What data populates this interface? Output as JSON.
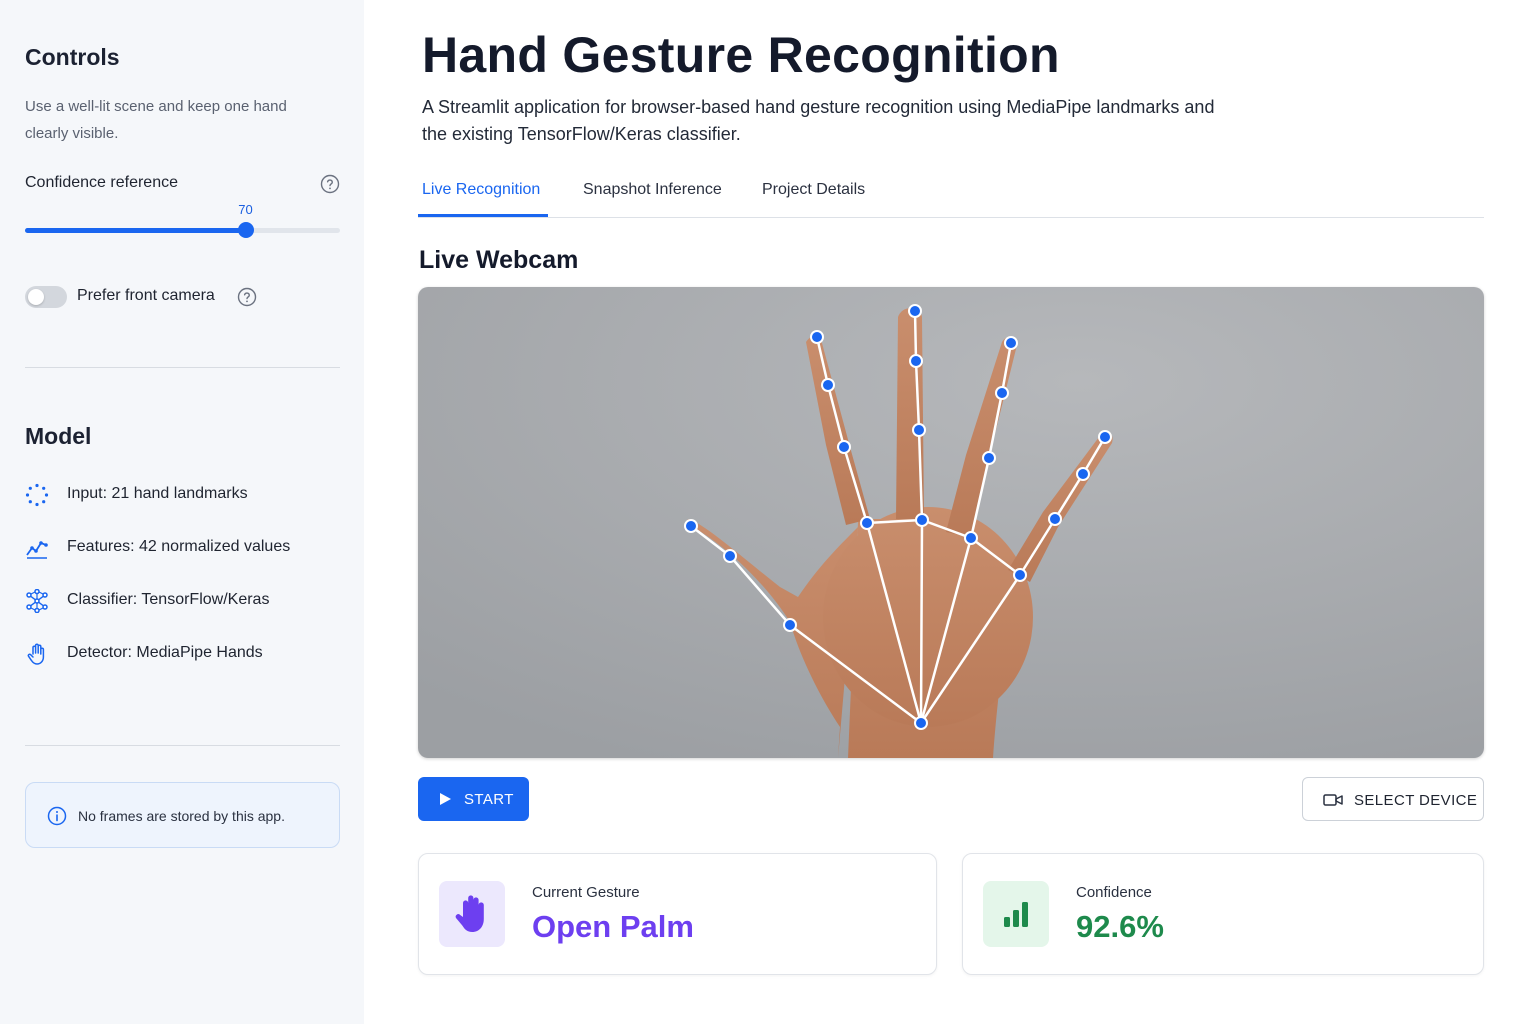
{
  "sidebar": {
    "controls_title": "Controls",
    "description": "Use a well-lit scene and keep one hand clearly visible.",
    "slider": {
      "label": "Confidence reference",
      "value": 70,
      "min": 0,
      "max": 100
    },
    "toggle": {
      "label": "Prefer front camera",
      "on": false
    },
    "model_title": "Model",
    "model_items": [
      {
        "icon": "landmarks-icon",
        "label": "Input: 21 hand landmarks"
      },
      {
        "icon": "trend-chart-icon",
        "label": "Features: 42 normalized values"
      },
      {
        "icon": "neural-network-icon",
        "label": "Classifier: TensorFlow/Keras"
      },
      {
        "icon": "hand-icon",
        "label": "Detector: MediaPipe Hands"
      }
    ],
    "info": {
      "icon": "info-icon",
      "text": "No frames are stored by this app."
    }
  },
  "main": {
    "title": "Hand Gesture Recognition",
    "subtitle": "A Streamlit application for browser-based hand gesture recognition using MediaPipe landmarks and the existing TensorFlow/Keras classifier.",
    "tabs": [
      {
        "label": "Live Recognition",
        "active": true
      },
      {
        "label": "Snapshot Inference",
        "active": false
      },
      {
        "label": "Project Details",
        "active": false
      }
    ],
    "section_title": "Live Webcam",
    "start_button": "START",
    "select_device_button": "SELECT DEVICE",
    "gesture_card": {
      "label": "Current Gesture",
      "value": "Open Palm",
      "icon": "hand-icon",
      "color": "#6d3ff0"
    },
    "confidence_card": {
      "label": "Confidence",
      "value": "92.6%",
      "icon": "signal-bars-icon",
      "color": "#1e8a4c"
    }
  },
  "colors": {
    "accent": "#1a66f0",
    "landmark": "#1a66f0",
    "gesture": "#6d3ff0",
    "confidence": "#1e8a4c"
  }
}
